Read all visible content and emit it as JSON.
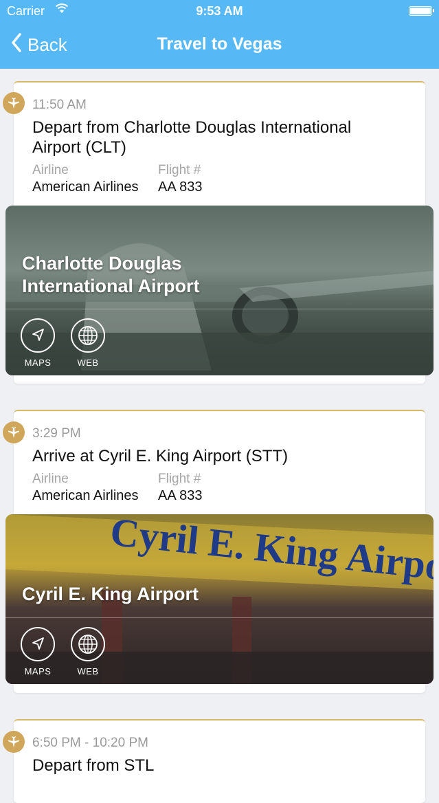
{
  "status_bar": {
    "carrier": "Carrier",
    "time": "9:53 AM"
  },
  "nav": {
    "back_label": "Back",
    "title": "Travel to Vegas"
  },
  "colors": {
    "nav_bg": "#56b8f5",
    "accent_gold": "#cfa65a"
  },
  "events": [
    {
      "time": "11:50 AM",
      "title": "Depart from Charlotte Douglas International Airport (CLT)",
      "airline_label": "Airline",
      "airline": "American Airlines",
      "flight_label": "Flight #",
      "flight": "AA 833",
      "place_name": "Charlotte Douglas International Airport",
      "maps_label": "MAPS",
      "web_label": "WEB"
    },
    {
      "time": "3:29 PM",
      "title": "Arrive at Cyril E. King Airport (STT)",
      "airline_label": "Airline",
      "airline": "American Airlines",
      "flight_label": "Flight #",
      "flight": "AA 833",
      "place_name": "Cyril E. King Airport",
      "sign_text": "Cyril E. King Airport",
      "maps_label": "MAPS",
      "web_label": "WEB"
    },
    {
      "time": "6:50 PM - 10:20 PM",
      "title": "Depart from STL"
    }
  ]
}
